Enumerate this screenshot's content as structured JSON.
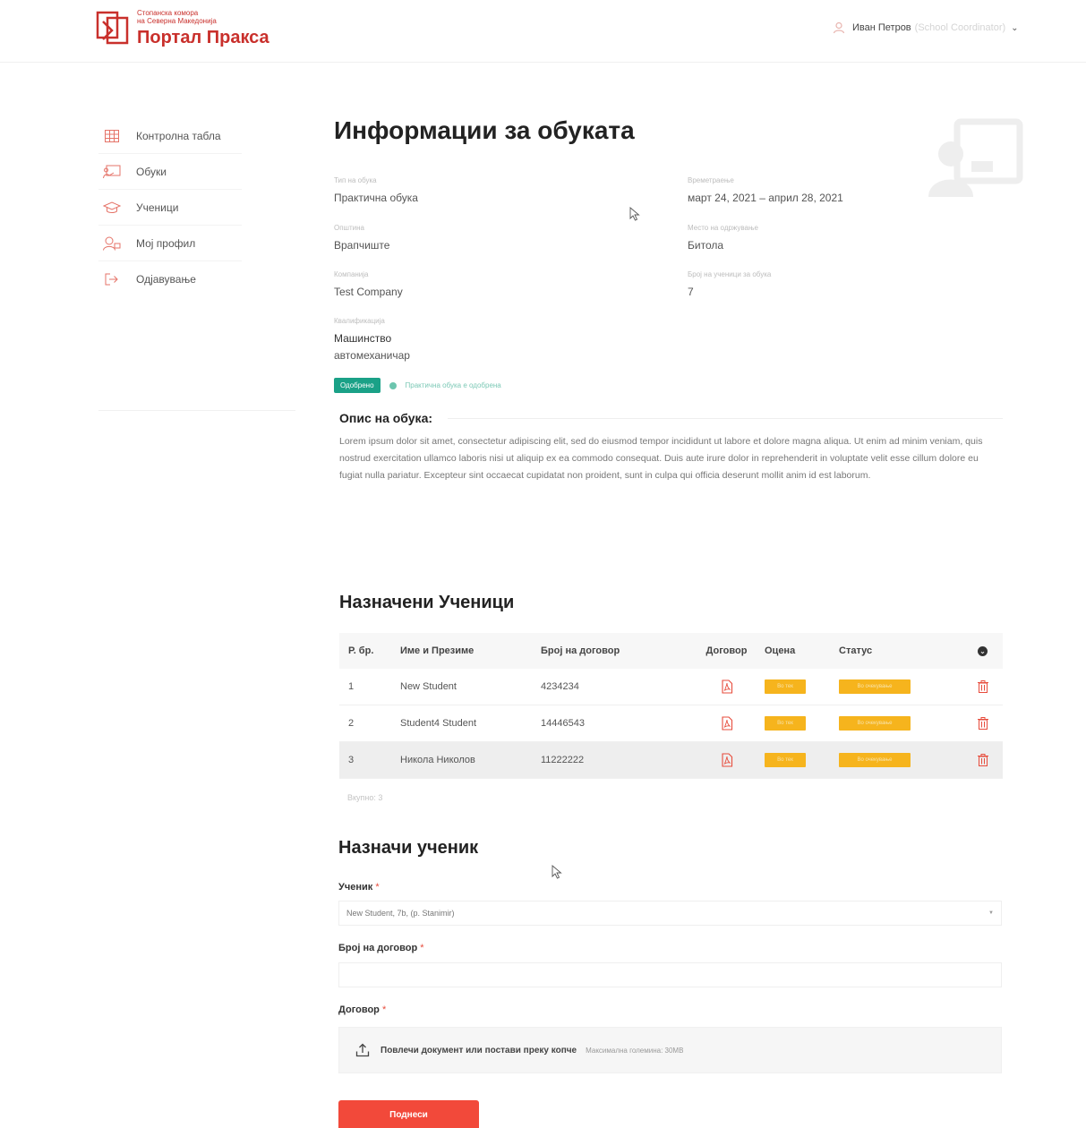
{
  "header": {
    "logo_org_line1": "Стопанска комора",
    "logo_org_line2": "на Северна Македонија",
    "logo_title": "Портал Пракса",
    "user_name": "Иван Петров",
    "user_role": "(School Coordinator)"
  },
  "sidebar": {
    "items": [
      {
        "label": "Контролна табла",
        "icon": "grid-icon"
      },
      {
        "label": "Обуки",
        "icon": "presentation-icon"
      },
      {
        "label": "Ученици",
        "icon": "graduation-cap-icon"
      },
      {
        "label": "Мој профил",
        "icon": "user-profile-icon"
      },
      {
        "label": "Одјавување",
        "icon": "logout-icon"
      }
    ]
  },
  "training": {
    "title": "Информации за обуката",
    "fields": {
      "type_label": "Тип на обука",
      "type_value": "Практична обука",
      "duration_label": "Времетраење",
      "duration_value": "март 24, 2021 – април 28, 2021",
      "municipality_label": "Општина",
      "municipality_value": "Врапчиште",
      "place_label": "Место на одржување",
      "place_value": "Битола",
      "company_label": "Компанија",
      "company_value": "Test Company",
      "students_needed_label": "Број на ученици за обука",
      "students_needed_value": "7",
      "qualification_label": "Квалификација",
      "qualification_value1": "Машинство",
      "qualification_value2": "автомеханичар"
    },
    "status_badge": "Одобрено",
    "status_text": "Практична обука е одобрена",
    "description_title": "Опис на обука:",
    "description": "Lorem ipsum dolor sit amet, consectetur adipiscing elit, sed do eiusmod tempor incididunt ut labore et dolore magna aliqua. Ut enim ad minim veniam, quis nostrud exercitation ullamco laboris nisi ut aliquip ex ea commodo consequat. Duis aute irure dolor in reprehenderit in voluptate velit esse cillum dolore eu fugiat nulla pariatur. Excepteur sint occaecat cupidatat non proident, sunt in culpa qui officia deserunt mollit anim id est laborum."
  },
  "assigned": {
    "title": "Назначени Ученици",
    "columns": [
      "Р. бр.",
      "Име и Презиме",
      "Број на договор",
      "Договор",
      "Оцена",
      "Статус"
    ],
    "rows": [
      {
        "num": "1",
        "name": "New Student",
        "contract": "4234234",
        "grade": "Во тек",
        "status": "Во очекување"
      },
      {
        "num": "2",
        "name": "Student4 Student",
        "contract": "14446543",
        "grade": "Во тек",
        "status": "Во очекување"
      },
      {
        "num": "3",
        "name": "Никола Николов",
        "contract": "11222222",
        "grade": "Во тек",
        "status": "Во очекување"
      }
    ],
    "total": "Вкупно: 3"
  },
  "assign_form": {
    "title": "Назначи ученик",
    "student_label": "Ученик",
    "student_value": "New Student, 7b, (p. Stanimir)",
    "contract_no_label": "Број на договор",
    "contract_label": "Договор",
    "required_mark": "*",
    "dropzone_text": "Повлечи документ или постави преку копче",
    "dropzone_max": "Максимална големина: 30MB",
    "submit_label": "Поднеси"
  },
  "colors": {
    "brand": "#c9302c",
    "approved": "#1aa187",
    "pending": "#f6b41d",
    "submit": "#f2493a"
  }
}
